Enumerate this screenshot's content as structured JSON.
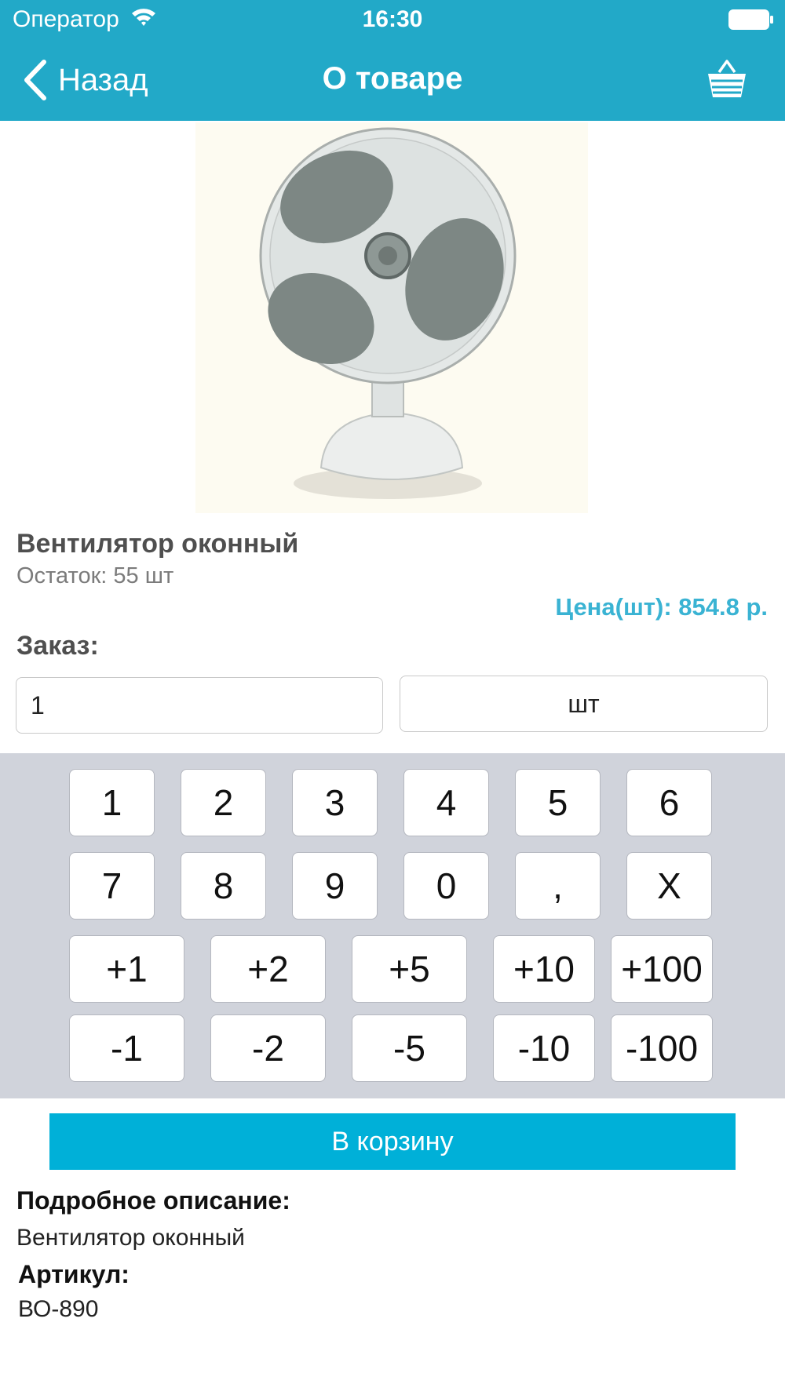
{
  "status_bar": {
    "carrier": "Оператор",
    "time": "16:30"
  },
  "nav": {
    "back_label": "Назад",
    "title": "О товаре",
    "cart_icon": "basket-icon"
  },
  "product": {
    "name": "Вентилятор оконный",
    "stock": "Остаток: 55 шт",
    "price": "Цена(шт): 854.8 р.",
    "image_icon": "desk-fan-image"
  },
  "order": {
    "label": "Заказ:",
    "quantity": "1",
    "unit": "шт"
  },
  "keypad": {
    "row1": [
      "1",
      "2",
      "3",
      "4",
      "5",
      "6"
    ],
    "row2": [
      "7",
      "8",
      "9",
      "0",
      ",",
      "X"
    ],
    "row3": [
      "+1",
      "+2",
      "+5",
      "+10",
      "+100"
    ],
    "row4": [
      "-1",
      "-2",
      "-5",
      "-10",
      "-100"
    ]
  },
  "add_to_cart_label": "В корзину",
  "details": {
    "description_label": "Подробное описание:",
    "description": "Вентилятор оконный",
    "sku_label": "Артикул:",
    "sku": "ВО-890"
  },
  "colors": {
    "header": "#22a9c8",
    "accent": "#00b0d8",
    "price": "#3ab3d3",
    "keypad_bg": "#d0d3db"
  }
}
